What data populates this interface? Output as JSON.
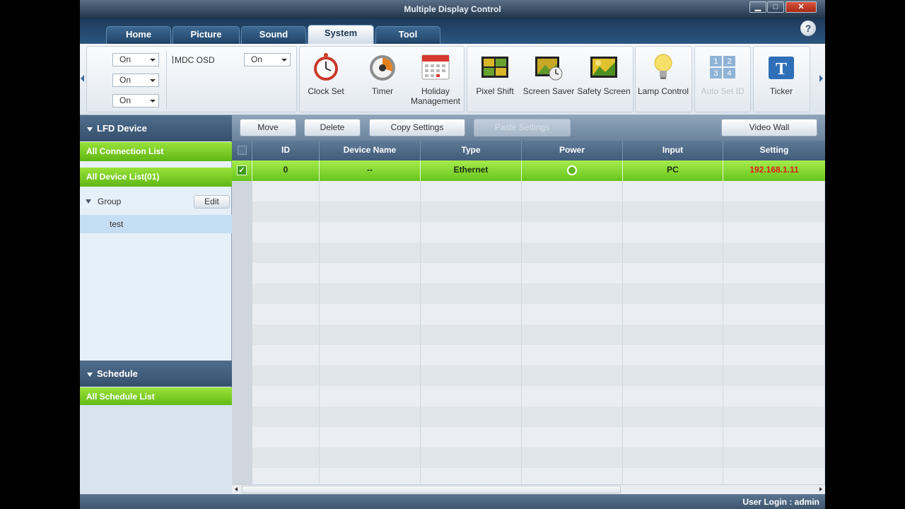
{
  "window": {
    "title": "Multiple Display Control"
  },
  "tabs": [
    "Home",
    "Picture",
    "Sound",
    "System",
    "Tool"
  ],
  "active_tab": "System",
  "help_label": "?",
  "ribbon": {
    "combos": [
      "On",
      "On",
      "On"
    ],
    "mdc_osd_label": "MDC OSD",
    "mdc_osd_value": "On",
    "buttons": [
      {
        "label": "Clock Set",
        "icon": "clock-icon",
        "enabled": true
      },
      {
        "label": "Timer",
        "icon": "timer-icon",
        "enabled": true
      },
      {
        "label": "Holiday Management",
        "icon": "calendar-icon",
        "enabled": true
      },
      {
        "label": "Pixel Shift",
        "icon": "pixel-shift-icon",
        "enabled": true
      },
      {
        "label": "Screen Saver",
        "icon": "screen-saver-icon",
        "enabled": true
      },
      {
        "label": "Safety Screen",
        "icon": "safety-screen-icon",
        "enabled": true
      },
      {
        "label": "Lamp Control",
        "icon": "lamp-icon",
        "enabled": true
      },
      {
        "label": "Auto Set ID",
        "icon": "auto-set-id-icon",
        "enabled": false
      },
      {
        "label": "Ticker",
        "icon": "ticker-icon",
        "enabled": true
      }
    ],
    "auto_set_id_digits": [
      "1",
      "2",
      "3",
      "4"
    ],
    "ticker_glyph": "T"
  },
  "left": {
    "lfd_header": "LFD Device",
    "all_connection": "All Connection List",
    "all_device": "All Device List(01)",
    "group_label": "Group",
    "edit_label": "Edit",
    "group_item": "test",
    "schedule_header": "Schedule",
    "all_schedule": "All Schedule List"
  },
  "toolbar": {
    "move": "Move",
    "delete": "Delete",
    "copy": "Copy Settings",
    "paste": "Paste Settings",
    "videowall": "Video Wall"
  },
  "grid": {
    "columns": [
      "ID",
      "Device Name",
      "Type",
      "Power",
      "Input",
      "Setting"
    ],
    "rows": [
      {
        "checked": true,
        "id": "0",
        "device_name": "--",
        "type": "Ethernet",
        "power": "on",
        "input": "PC",
        "setting": "192.168.1.11"
      }
    ]
  },
  "status": {
    "user_login": "User Login : admin"
  },
  "colors": {
    "accent_green": "#7fd12b",
    "setting_red": "#e01b1b",
    "header_blue": "#35506c"
  }
}
